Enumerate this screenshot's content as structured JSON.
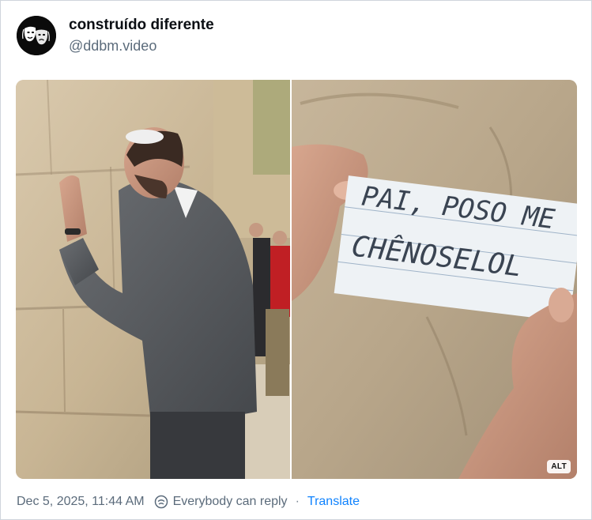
{
  "post": {
    "author": {
      "display_name": "construído diferente",
      "handle": "@ddbm.video",
      "avatar_icon": "theater-masks-icon"
    },
    "media": {
      "alt_badge": "ALT",
      "note_text_line1": "PAI, POSO ME",
      "note_text_line2": "CHÊNOSELOL"
    },
    "footer": {
      "timestamp": "Dec 5, 2025, 11:44 AM",
      "reply_setting": "Everybody can reply",
      "separator": "·",
      "translate_label": "Translate"
    }
  },
  "colors": {
    "link": "#1083fe",
    "muted": "#5b6b7b",
    "border": "#cfd5dc"
  }
}
